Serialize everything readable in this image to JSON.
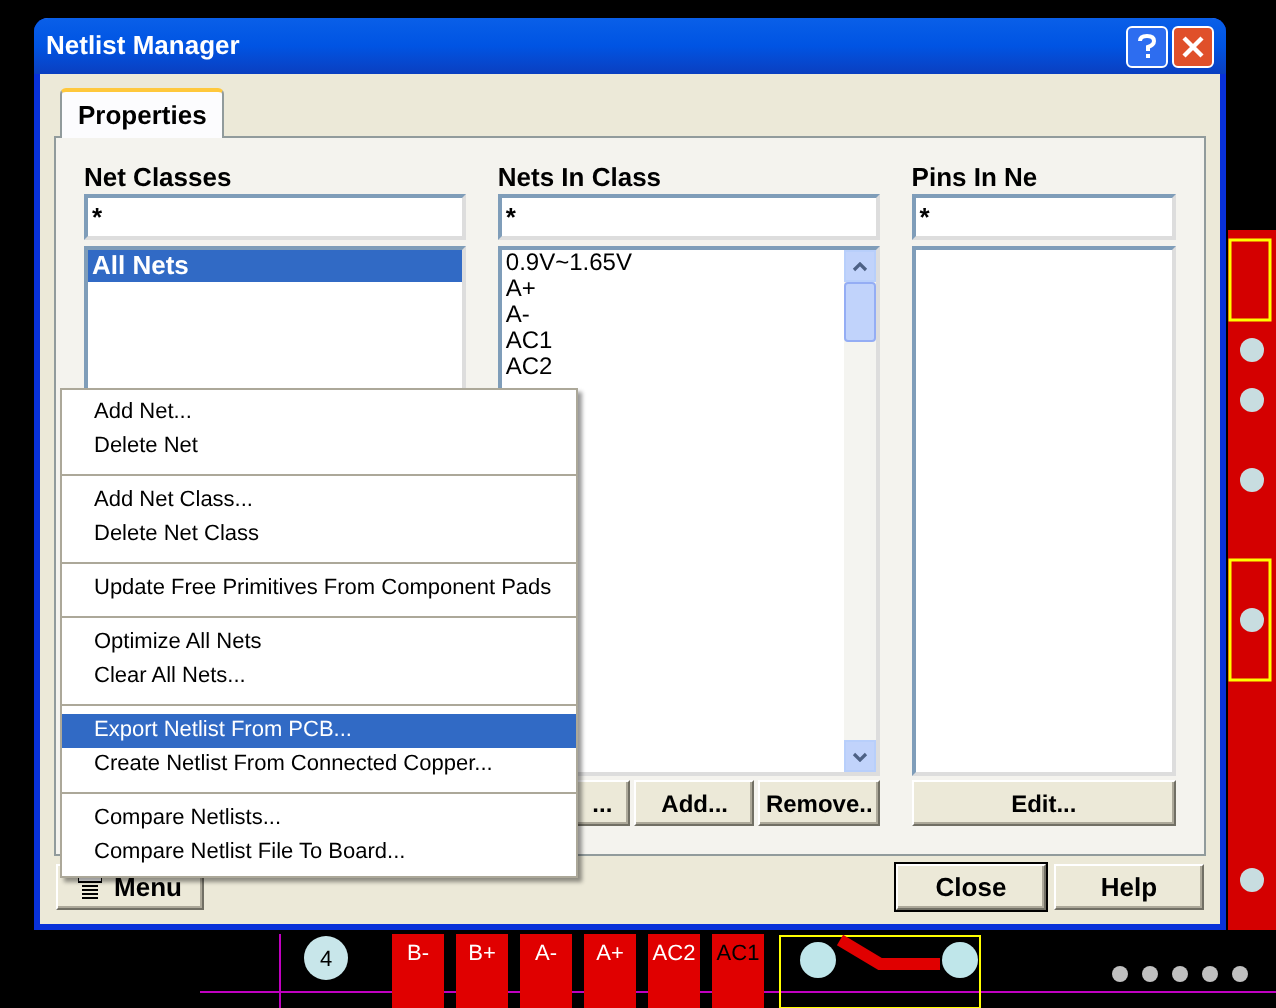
{
  "window": {
    "title": "Netlist Manager"
  },
  "tabs": [
    {
      "label": "Properties",
      "selected": true
    }
  ],
  "columns": [
    {
      "heading": "Net Classes",
      "filter": "*",
      "items": [
        {
          "label": "All Nets",
          "selected": true
        }
      ]
    },
    {
      "heading": "Nets In Class",
      "filter": "*",
      "items": [
        {
          "label": "0.9V~1.65V",
          "selected": false
        },
        {
          "label": "A+",
          "selected": false
        },
        {
          "label": "A-",
          "selected": false
        },
        {
          "label": "AC1",
          "selected": false
        },
        {
          "label": "AC2",
          "selected": false
        }
      ]
    },
    {
      "heading": "Pins In Ne",
      "filter": "*"
    }
  ],
  "net_buttons": [
    "...",
    "Add...",
    "Remove.."
  ],
  "pin_buttons": [
    "Edit..."
  ],
  "menu_button": "Menu",
  "dialog_buttons": [
    {
      "label": "Close",
      "default": true
    },
    {
      "label": "Help",
      "default": false
    }
  ],
  "context_menu": [
    [
      {
        "label": "Add Net...",
        "selected": false
      },
      {
        "label": "Delete Net",
        "selected": false
      }
    ],
    [
      {
        "label": "Add Net Class...",
        "selected": false
      },
      {
        "label": "Delete Net Class",
        "selected": false
      }
    ],
    [
      {
        "label": "Update Free Primitives From Component Pads",
        "selected": false
      }
    ],
    [
      {
        "label": "Optimize All Nets",
        "selected": false
      },
      {
        "label": "Clear All Nets...",
        "selected": false
      }
    ],
    [
      {
        "label": "Export Netlist From PCB...",
        "selected": true
      },
      {
        "label": "Create Netlist From Connected Copper...",
        "selected": false
      }
    ],
    [
      {
        "label": "Compare Netlists...",
        "selected": false
      },
      {
        "label": "Compare Netlist File To Board...",
        "selected": false
      }
    ]
  ],
  "pcb_labels": [
    "4",
    "B-",
    "B+",
    "A-",
    "A+",
    "AC2",
    "AC1"
  ]
}
